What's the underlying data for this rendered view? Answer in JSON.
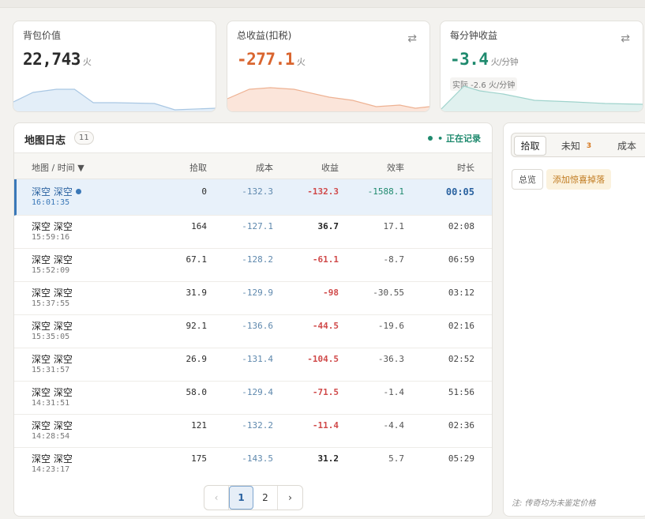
{
  "cards": [
    {
      "label": "背包价值",
      "value": "22,743",
      "unit": "火",
      "color": "#2b2b2b"
    },
    {
      "label": "总收益(扣税)",
      "value": "-277.1",
      "unit": "火",
      "color": "#d9652f"
    },
    {
      "label": "每分钟收益",
      "value": "-3.4",
      "unit": "火/分钟",
      "color": "#1f8a6e",
      "sub": "实际 -2.6 火/分钟"
    }
  ],
  "swap_icon": "⇄",
  "log": {
    "title": "地图日志",
    "count": "11",
    "recording": "• 正在记录",
    "headers": {
      "map": "地图 / 时间 ▼",
      "pickup": "拾取",
      "cost": "成本",
      "profit": "收益",
      "efficiency": "效率",
      "duration": "时长"
    },
    "rows": [
      {
        "map": "深空 深空",
        "time": "16:01:35",
        "pickup": "0",
        "cost": "-132.3",
        "profit": "-132.3",
        "efficiency": "-1588.1",
        "duration": "00:05",
        "active": true
      },
      {
        "map": "深空 深空",
        "time": "15:59:16",
        "pickup": "164",
        "cost": "-127.1",
        "profit": "36.7",
        "efficiency": "17.1",
        "duration": "02:08"
      },
      {
        "map": "深空 深空",
        "time": "15:52:09",
        "pickup": "67.1",
        "cost": "-128.2",
        "profit": "-61.1",
        "efficiency": "-8.7",
        "duration": "06:59"
      },
      {
        "map": "深空 深空",
        "time": "15:37:55",
        "pickup": "31.9",
        "cost": "-129.9",
        "profit": "-98",
        "efficiency": "-30.55",
        "duration": "03:12"
      },
      {
        "map": "深空 深空",
        "time": "15:35:05",
        "pickup": "92.1",
        "cost": "-136.6",
        "profit": "-44.5",
        "efficiency": "-19.6",
        "duration": "02:16"
      },
      {
        "map": "深空 深空",
        "time": "15:31:57",
        "pickup": "26.9",
        "cost": "-131.4",
        "profit": "-104.5",
        "efficiency": "-36.3",
        "duration": "02:52"
      },
      {
        "map": "深空 深空",
        "time": "14:31:51",
        "pickup": "58.0",
        "cost": "-129.4",
        "profit": "-71.5",
        "efficiency": "-1.4",
        "duration": "51:56"
      },
      {
        "map": "深空 深空",
        "time": "14:28:54",
        "pickup": "121",
        "cost": "-132.2",
        "profit": "-11.4",
        "efficiency": "-4.4",
        "duration": "02:36"
      },
      {
        "map": "深空 深空",
        "time": "14:23:17",
        "pickup": "175",
        "cost": "-143.5",
        "profit": "31.2",
        "efficiency": "5.7",
        "duration": "05:29"
      }
    ],
    "pager": {
      "prev": "‹",
      "pages": [
        "1",
        "2"
      ],
      "next": "›",
      "current": "1"
    }
  },
  "side": {
    "tabs": [
      {
        "label": "拾取",
        "active": true
      },
      {
        "label": "未知",
        "badge": "3"
      },
      {
        "label": "成本"
      }
    ],
    "overview_button": "总览",
    "add_button": "添加惊喜掉落",
    "note": "注: 传奇均为未鉴定价格"
  }
}
